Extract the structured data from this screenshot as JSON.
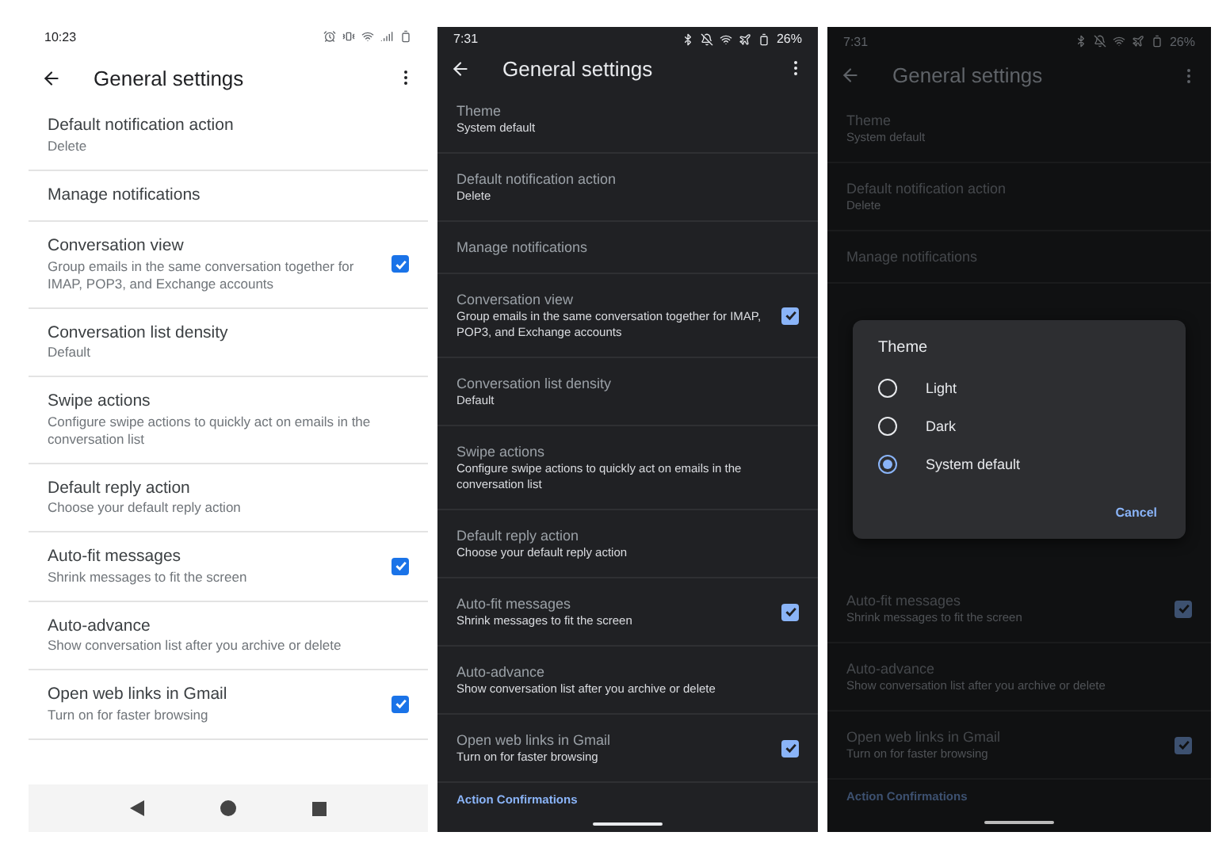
{
  "screens": [
    {
      "kind": "light",
      "dimmed": false,
      "status_bar": {
        "time": "10:23"
      },
      "app_bar": {
        "title": "General settings"
      },
      "nav_bar": {
        "kind": "buttons"
      },
      "rows": [
        {
          "kind": "plain",
          "title": "Default notification action",
          "subtitle": "Delete"
        },
        {
          "kind": "plain",
          "title": "Manage notifications"
        },
        {
          "kind": "checkbox",
          "title": "Conversation view",
          "subtitle": "Group emails in the same conversation together for IMAP, POP3, and Exchange accounts",
          "checked": true
        },
        {
          "kind": "plain",
          "title": "Conversation list density",
          "subtitle": "Default"
        },
        {
          "kind": "plain",
          "title": "Swipe actions",
          "subtitle": "Configure swipe actions to quickly act on emails in the conversation list"
        },
        {
          "kind": "plain",
          "title": "Default reply action",
          "subtitle": "Choose your default reply action"
        },
        {
          "kind": "checkbox",
          "title": "Auto-fit messages",
          "subtitle": "Shrink messages to fit the screen",
          "checked": true
        },
        {
          "kind": "plain",
          "title": "Auto-advance",
          "subtitle": "Show conversation list after you archive or delete"
        },
        {
          "kind": "checkbox",
          "title": "Open web links in Gmail",
          "subtitle": "Turn on for faster browsing",
          "checked": true
        }
      ]
    },
    {
      "kind": "dark",
      "dimmed": false,
      "status_bar": {
        "time": "7:31",
        "battery": "26%"
      },
      "app_bar": {
        "title": "General settings"
      },
      "nav_bar": {
        "kind": "gesture"
      },
      "section_header": "Action Confirmations",
      "rows": [
        {
          "kind": "plain",
          "title": "Theme",
          "subtitle": "System default"
        },
        {
          "kind": "plain",
          "title": "Default notification action",
          "subtitle": "Delete"
        },
        {
          "kind": "plain",
          "title": "Manage notifications"
        },
        {
          "kind": "checkbox",
          "title": "Conversation view",
          "subtitle": "Group emails in the same conversation together for IMAP, POP3, and Exchange accounts",
          "checked": true
        },
        {
          "kind": "plain",
          "title": "Conversation list density",
          "subtitle": "Default"
        },
        {
          "kind": "plain",
          "title": "Swipe actions",
          "subtitle": "Configure swipe actions to quickly act on emails in the conversation list"
        },
        {
          "kind": "plain",
          "title": "Default reply action",
          "subtitle": "Choose your default reply action"
        },
        {
          "kind": "checkbox",
          "title": "Auto-fit messages",
          "subtitle": "Shrink messages to fit the screen",
          "checked": true
        },
        {
          "kind": "plain",
          "title": "Auto-advance",
          "subtitle": "Show conversation list after you archive or delete"
        },
        {
          "kind": "checkbox",
          "title": "Open web links in Gmail",
          "subtitle": "Turn on for faster browsing",
          "checked": true
        }
      ]
    },
    {
      "kind": "dark",
      "dimmed": true,
      "status_bar": {
        "time": "7:31",
        "battery": "26%"
      },
      "app_bar": {
        "title": "General settings"
      },
      "nav_bar": {
        "kind": "gesture"
      },
      "section_header": "Action Confirmations",
      "rows": [
        {
          "kind": "plain",
          "title": "Theme",
          "subtitle": "System default"
        },
        {
          "kind": "plain",
          "title": "Default notification action",
          "subtitle": "Delete"
        },
        {
          "kind": "plain",
          "title": "Manage notifications"
        }
      ],
      "dialog": {
        "title": "Theme",
        "options": [
          {
            "label": "Light",
            "selected": false
          },
          {
            "label": "Dark",
            "selected": false
          },
          {
            "label": "System default",
            "selected": true
          }
        ],
        "button": "Cancel"
      },
      "rows_below": [
        {
          "kind": "checkbox",
          "title": "Auto-fit messages",
          "subtitle": "Shrink messages to fit the screen",
          "checked": true
        },
        {
          "kind": "plain",
          "title": "Auto-advance",
          "subtitle": "Show conversation list after you archive or delete"
        },
        {
          "kind": "checkbox",
          "title": "Open web links in Gmail",
          "subtitle": "Turn on for faster browsing",
          "checked": true
        }
      ]
    }
  ]
}
